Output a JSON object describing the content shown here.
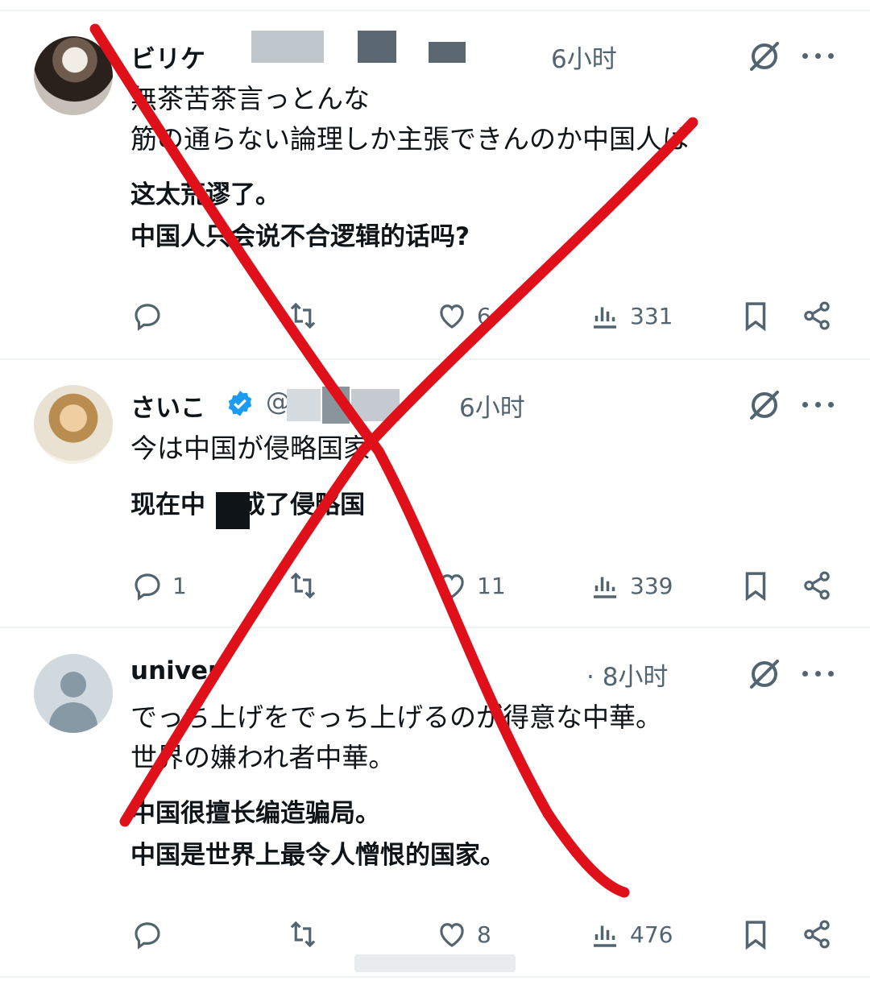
{
  "posts": [
    {
      "name": "ビリケ",
      "time": "6小时",
      "ja": "無茶苦茶言っとんな\n筋の通らない論理しか主張できんのか中国人は",
      "zh": "这太荒谬了。\n中国人只会说不合逻辑的话吗?",
      "reply": "",
      "retweet": "",
      "like": "6",
      "views": "331"
    },
    {
      "name": "さいこ",
      "handle": "@",
      "time": "6小时",
      "ja": "今は中国が侵略国家",
      "zh": "现在中    成了侵略国",
      "reply": "1",
      "retweet": "",
      "like": "11",
      "views": "339"
    },
    {
      "name": "univer",
      "time": "· 8小时",
      "ja": "でっち上げをでっち上げるのが得意な中華。\n世界の嫌われ者中華。",
      "zh": "中国很擅长编造骗局。\n中国是世界上最令人憎恨的国家。",
      "reply": "",
      "retweet": "",
      "like": "8",
      "views": "476"
    }
  ],
  "colors": {
    "accent": "#1d9bf0",
    "text": "#0f1419",
    "secondary": "#536471",
    "cross": "#e0101b"
  },
  "icons": [
    "reply-icon",
    "retweet-icon",
    "like-icon",
    "views-icon",
    "bookmark-icon",
    "share-icon",
    "grok-icon",
    "more-icon",
    "verified-icon"
  ]
}
